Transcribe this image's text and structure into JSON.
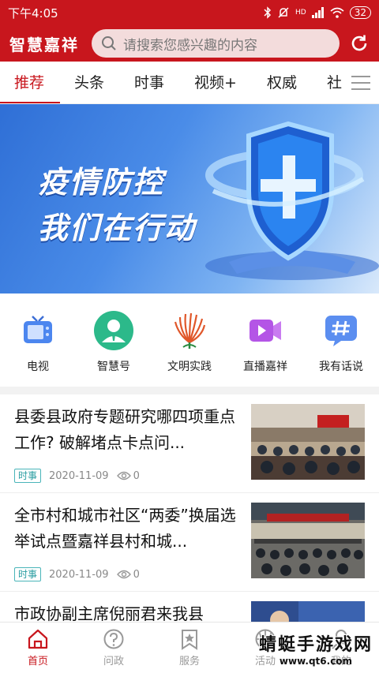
{
  "status_bar": {
    "time": "下午4:05",
    "network": "HD",
    "battery": "32"
  },
  "header": {
    "brand": "智慧嘉祥",
    "search_placeholder": "请搜索您感兴趣的内容"
  },
  "tabs": [
    {
      "label": "推荐",
      "active": true
    },
    {
      "label": "头条"
    },
    {
      "label": "时事"
    },
    {
      "label": "视频+"
    },
    {
      "label": "权威"
    },
    {
      "label": "社"
    }
  ],
  "banner": {
    "line1": "疫情防控",
    "line2": "我们在行动"
  },
  "shortcuts": [
    {
      "label": "电视",
      "icon": "tv-icon"
    },
    {
      "label": "智慧号",
      "icon": "person-icon"
    },
    {
      "label": "文明实践",
      "icon": "flame-icon"
    },
    {
      "label": "直播嘉祥",
      "icon": "video-camera-icon"
    },
    {
      "label": "我有话说",
      "icon": "hashtag-icon"
    }
  ],
  "news": [
    {
      "title": "县委县政府专题研究哪四项重点工作? 破解堵点卡点问...",
      "tag": "时事",
      "date": "2020-11-09",
      "views": "0"
    },
    {
      "title": "全市村和城市社区“两委”换届选举试点暨嘉祥县村和城...",
      "tag": "时事",
      "date": "2020-11-09",
      "views": "0"
    },
    {
      "title": "市政协副主席倪丽君来我县"
    }
  ],
  "bottom_nav": [
    {
      "label": "首页",
      "active": true
    },
    {
      "label": "问政"
    },
    {
      "label": "服务"
    },
    {
      "label": "活动"
    },
    {
      "label": "我的"
    }
  ],
  "watermark": {
    "title": "蜻蜓手游戏网",
    "url": "www.qt6.com"
  },
  "colors": {
    "brand_red": "#c8161d",
    "tag_teal": "#2a9da1"
  }
}
